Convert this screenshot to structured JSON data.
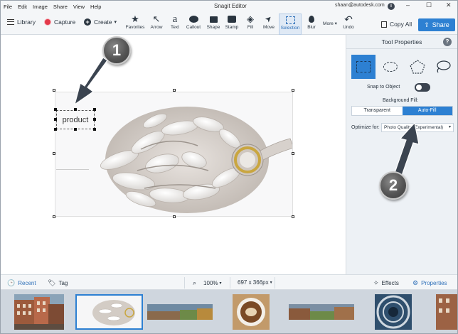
{
  "menubar": {
    "items": [
      "File",
      "Edit",
      "Image",
      "Share",
      "View",
      "Help"
    ],
    "title": "Snagit Editor",
    "account": "shaan@autodesk.com",
    "info_glyph": "i",
    "minimize_glyph": "–",
    "maximize_glyph": "☐",
    "close_glyph": "✕"
  },
  "toolbar": {
    "library_label": "Library",
    "capture_label": "Capture",
    "create_label": "Create",
    "create_caret": "▾",
    "tools": [
      {
        "label": "Favorites",
        "glyph": "★",
        "icon": "star-icon"
      },
      {
        "label": "Arrow",
        "glyph": "↖",
        "icon": "arrow-icon"
      },
      {
        "label": "Text",
        "glyph": "a",
        "icon": "text-icon"
      },
      {
        "label": "Callout",
        "glyph": "💬",
        "icon": "callout-icon"
      },
      {
        "label": "Shape",
        "glyph": "◼",
        "icon": "shape-icon"
      },
      {
        "label": "Stamp",
        "glyph": "⬛",
        "icon": "stamp-icon"
      },
      {
        "label": "Fill",
        "glyph": "◈",
        "icon": "fill-icon"
      },
      {
        "label": "Move",
        "glyph": "➤",
        "icon": "move-icon"
      },
      {
        "label": "Selection",
        "glyph": "",
        "icon": "selection-icon"
      },
      {
        "label": "Blur",
        "glyph": "💧",
        "icon": "blur-icon"
      },
      {
        "label": "More",
        "glyph": "",
        "icon": "more-icon"
      },
      {
        "label": "Undo",
        "glyph": "↶",
        "icon": "undo-icon"
      }
    ],
    "more_caret": "▾",
    "copy_all_label": "Copy All",
    "share_label": "Share"
  },
  "canvas": {
    "text_annotation": "product",
    "callout_1": "1",
    "callout_2": "2"
  },
  "properties": {
    "title": "Tool Properties",
    "help_glyph": "?",
    "snap_label": "Snap to Object",
    "background_fill_label": "Background Fill:",
    "fill_options": [
      "Transparent",
      "Auto-Fill"
    ],
    "fill_selected": "Auto-Fill",
    "optimize_label": "Optimize for:",
    "optimize_value": "Photo Quality (Experimental)",
    "optimize_caret": "▾"
  },
  "statusbar": {
    "recent_label": "Recent",
    "tag_label": "Tag",
    "zoom_value": "100%",
    "dimensions_value": "697 x 366px",
    "caret": "▾",
    "effects_label": "Effects",
    "properties_label": "Properties"
  },
  "colors": {
    "accent": "#2d80d2",
    "capture_red": "#e3394a",
    "dark": "#2a3540"
  }
}
